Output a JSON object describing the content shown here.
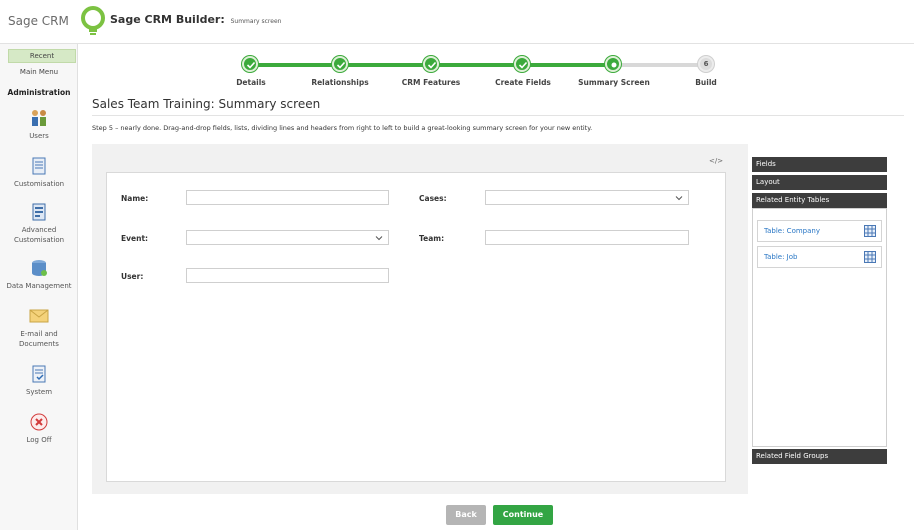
{
  "header": {
    "brand": "Sage CRM",
    "builder_title": "Sage CRM Builder:",
    "builder_subtitle": "Summary screen"
  },
  "sidebar": {
    "recent": "Recent",
    "main_menu": "Main Menu",
    "section": "Administration",
    "items": [
      {
        "label": "Users",
        "icon": "users-icon"
      },
      {
        "label": "Customisation",
        "icon": "document-icon"
      },
      {
        "label": "Advanced Customisation",
        "icon": "advanced-document-icon"
      },
      {
        "label": "Data Management",
        "icon": "database-icon"
      },
      {
        "label": "E-mail and Documents",
        "icon": "envelope-icon"
      },
      {
        "label": "System",
        "icon": "system-checklist-icon"
      },
      {
        "label": "Log Off",
        "icon": "log-off-icon"
      }
    ]
  },
  "stepper": {
    "steps": [
      {
        "label": "Details",
        "status": "done"
      },
      {
        "label": "Relationships",
        "status": "done"
      },
      {
        "label": "CRM Features",
        "status": "done"
      },
      {
        "label": "Create Fields",
        "status": "done"
      },
      {
        "label": "Summary Screen",
        "status": "current"
      },
      {
        "label": "Build",
        "status": "pending",
        "number": "6"
      }
    ]
  },
  "page": {
    "title": "Sales Team Training: Summary screen",
    "instructions": "Step 5 – nearly done. Drag-and-drop fields, lists, dividing lines and headers from right to left to build a great-looking summary screen for your new entity.",
    "code_toggle": "</>"
  },
  "form": {
    "name_label": "Name:",
    "name_value": "",
    "cases_label": "Cases:",
    "cases_value": "",
    "event_label": "Event:",
    "event_value": "",
    "team_label": "Team:",
    "team_value": "",
    "user_label": "User:",
    "user_value": ""
  },
  "right_panel": {
    "fields": "Fields",
    "layout": "Layout",
    "related_entity_tables": "Related Entity Tables",
    "tables": [
      "Table: Company",
      "Table: Job"
    ],
    "related_field_groups": "Related Field Groups"
  },
  "buttons": {
    "back": "Back",
    "continue": "Continue"
  },
  "colors": {
    "accent_green": "#3caa3c",
    "dark_panel": "#3d3d3d",
    "link_blue": "#2a77c5"
  }
}
